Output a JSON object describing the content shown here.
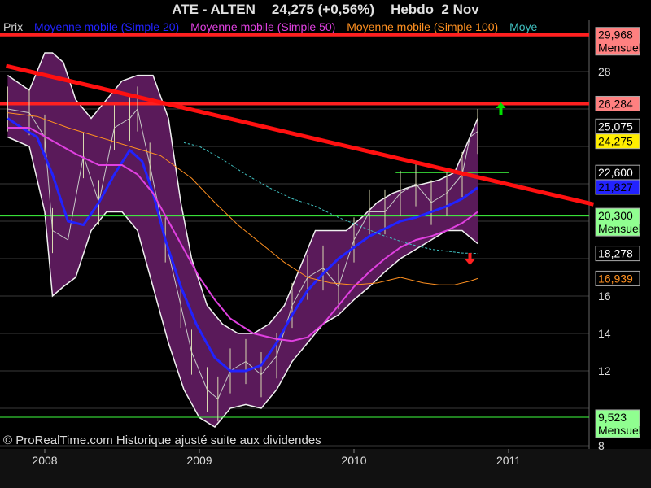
{
  "header": {
    "ticker": "ATE - ALTEN",
    "quote": "24,275 (+0,56%)",
    "period": "Hebdo  2 Nov"
  },
  "legend": [
    {
      "label": "Prix",
      "color": "#cccccc"
    },
    {
      "label": "Moyenne mobile (Simple 20)",
      "color": "#2222ff"
    },
    {
      "label": "Moyenne mobile (Simple 50)",
      "color": "#e040e0"
    },
    {
      "label": "Moyenne mobile (Simple 100)",
      "color": "#ff9020"
    },
    {
      "label": "Moye",
      "color": "#40c0c0"
    }
  ],
  "watermark": "© ProRealTime.com Historique ajusté suite aux dividendes",
  "chart_data": {
    "type": "line",
    "x_tick_labels": [
      "2008",
      "2009",
      "2010",
      "2011"
    ],
    "y_tick_labels": [
      "8",
      "12",
      "14",
      "16",
      "28"
    ],
    "ylim": [
      8,
      31
    ],
    "price_labels": [
      {
        "text": "29,968",
        "value": 29.968,
        "bg": "#ff8080",
        "fg": "#000000",
        "sub": "Mensuel"
      },
      {
        "text": "26,284",
        "value": 26.284,
        "bg": "#ff8080",
        "fg": "#000000",
        "sub": ""
      },
      {
        "text": "25,075",
        "value": 25.075,
        "bg": "#000000",
        "fg": "#ffffff",
        "sub": ""
      },
      {
        "text": "24,275",
        "value": 24.275,
        "bg": "#ffee00",
        "fg": "#000000",
        "sub": ""
      },
      {
        "text": "22,600",
        "value": 22.6,
        "bg": "#000000",
        "fg": "#ffffff",
        "sub": ""
      },
      {
        "text": "21,827",
        "value": 21.827,
        "bg": "#2222ff",
        "fg": "#000000",
        "sub": ""
      },
      {
        "text": "20,300",
        "value": 20.3,
        "bg": "#90ff90",
        "fg": "#000000",
        "sub": "Mensuel"
      },
      {
        "text": "18,278",
        "value": 18.278,
        "bg": "#000000",
        "fg": "#ffffff",
        "sub": ""
      },
      {
        "text": "16,939",
        "value": 16.939,
        "bg": "#000000",
        "fg": "#ff9020",
        "sub": ""
      },
      {
        "text": "9,523",
        "value": 9.523,
        "bg": "#90ff90",
        "fg": "#000000",
        "sub": "Mensuel"
      }
    ],
    "horizontal_levels": [
      {
        "value": 29.968,
        "color": "#ff2020",
        "width": 4
      },
      {
        "value": 26.284,
        "color": "#ff2020",
        "width": 4
      },
      {
        "value": 20.3,
        "color": "#40ff40",
        "width": 2
      },
      {
        "value": 9.523,
        "color": "#40ff40",
        "width": 1
      }
    ],
    "trendline": {
      "x": [
        2007.75,
        2011.55
      ],
      "y": [
        28.3,
        20.9
      ],
      "color": "#ff1010"
    },
    "resistance_segment": {
      "x": [
        2010.27,
        2011.0
      ],
      "y": [
        22.6,
        22.6
      ],
      "color": "#40ff40"
    },
    "series": [
      {
        "name": "Prix",
        "color": "#c8c8c8",
        "x": [
          2007.76,
          2007.9,
          2008.0,
          2008.05,
          2008.15,
          2008.25,
          2008.35,
          2008.45,
          2008.55,
          2008.6,
          2008.68,
          2008.78,
          2008.88,
          2008.95,
          2009.05,
          2009.12,
          2009.2,
          2009.3,
          2009.4,
          2009.5,
          2009.6,
          2009.7,
          2009.8,
          2009.9,
          2010.0,
          2010.1,
          2010.2,
          2010.3,
          2010.4,
          2010.5,
          2010.6,
          2010.7,
          2010.75,
          2010.8
        ],
        "y": [
          26.0,
          25.8,
          24.5,
          19.5,
          19.0,
          23.5,
          21.0,
          25.0,
          25.5,
          26.0,
          23.0,
          19.0,
          15.5,
          13.0,
          11.0,
          10.5,
          12.0,
          12.5,
          11.8,
          12.8,
          15.5,
          17.0,
          17.5,
          16.5,
          19.0,
          20.5,
          20.5,
          21.5,
          22.0,
          21.0,
          21.5,
          22.5,
          24.5,
          24.8
        ]
      },
      {
        "name": "Moyenne mobile (Simple 20)",
        "color": "#2222ff",
        "x": [
          2007.76,
          2007.85,
          2007.95,
          2008.05,
          2008.15,
          2008.25,
          2008.35,
          2008.45,
          2008.55,
          2008.63,
          2008.7,
          2008.78,
          2008.88,
          2008.98,
          2009.1,
          2009.2,
          2009.3,
          2009.4,
          2009.5,
          2009.6,
          2009.7,
          2009.8,
          2009.9,
          2010.0,
          2010.1,
          2010.2,
          2010.3,
          2010.4,
          2010.5,
          2010.6,
          2010.7,
          2010.8
        ],
        "y": [
          25.5,
          25.0,
          24.5,
          22.5,
          20.0,
          19.8,
          21.0,
          22.5,
          23.8,
          23.2,
          21.5,
          19.0,
          16.5,
          14.5,
          12.7,
          12.0,
          12.0,
          12.3,
          13.5,
          15.0,
          16.3,
          17.2,
          18.0,
          18.6,
          19.2,
          19.6,
          20.0,
          20.2,
          20.5,
          20.8,
          21.2,
          21.8
        ]
      },
      {
        "name": "Moyenne mobile (Simple 50)",
        "color": "#e040e0",
        "x": [
          2007.76,
          2007.9,
          2008.05,
          2008.2,
          2008.35,
          2008.5,
          2008.6,
          2008.7,
          2008.8,
          2008.9,
          2009.0,
          2009.1,
          2009.2,
          2009.35,
          2009.5,
          2009.6,
          2009.7,
          2009.8,
          2009.9,
          2010.0,
          2010.1,
          2010.2,
          2010.3,
          2010.4,
          2010.5,
          2010.6,
          2010.7,
          2010.8
        ],
        "y": [
          25.0,
          25.0,
          24.3,
          23.6,
          23.0,
          23.0,
          22.5,
          21.5,
          20.0,
          18.5,
          17.0,
          15.8,
          14.8,
          14.0,
          13.7,
          13.6,
          13.8,
          14.5,
          15.5,
          16.5,
          17.3,
          18.0,
          18.6,
          19.0,
          19.2,
          19.5,
          19.9,
          20.5
        ]
      },
      {
        "name": "Moyenne mobile (Simple 100)",
        "color": "#ff9020",
        "x": [
          2007.76,
          2007.95,
          2008.15,
          2008.35,
          2008.55,
          2008.75,
          2008.95,
          2009.1,
          2009.25,
          2009.4,
          2009.55,
          2009.7,
          2009.85,
          2010.0,
          2010.15,
          2010.3,
          2010.45,
          2010.55,
          2010.65,
          2010.75,
          2010.8
        ],
        "y": [
          25.8,
          25.6,
          25.0,
          24.5,
          24.0,
          23.5,
          22.3,
          21.0,
          19.8,
          18.8,
          17.8,
          17.0,
          16.7,
          16.6,
          16.7,
          17.0,
          16.7,
          16.6,
          16.6,
          16.8,
          16.94
        ]
      },
      {
        "name": "Moye",
        "color": "#40c0c0",
        "x": [
          2008.9,
          2009.0,
          2009.15,
          2009.3,
          2009.45,
          2009.6,
          2009.75,
          2009.9,
          2010.05,
          2010.2,
          2010.35,
          2010.5,
          2010.6,
          2010.7,
          2010.8
        ],
        "y": [
          24.2,
          24.0,
          23.3,
          22.5,
          21.8,
          21.2,
          20.8,
          20.2,
          19.7,
          19.2,
          18.8,
          18.5,
          18.4,
          18.3,
          18.28
        ]
      }
    ],
    "bollinger_upper": {
      "x": [
        2007.76,
        2007.9,
        2008.0,
        2008.05,
        2008.12,
        2008.2,
        2008.3,
        2008.4,
        2008.5,
        2008.6,
        2008.7,
        2008.8,
        2008.88,
        2008.95,
        2009.05,
        2009.15,
        2009.25,
        2009.35,
        2009.45,
        2009.55,
        2009.65,
        2009.75,
        2009.85,
        2009.95,
        2010.05,
        2010.15,
        2010.25,
        2010.35,
        2010.45,
        2010.55,
        2010.65,
        2010.75,
        2010.8
      ],
      "y": [
        27.8,
        27.0,
        29.0,
        29.0,
        28.5,
        26.5,
        25.5,
        26.5,
        27.5,
        27.8,
        27.8,
        25.5,
        21.0,
        18.0,
        15.5,
        14.5,
        14.0,
        14.0,
        14.5,
        15.5,
        17.5,
        19.5,
        19.5,
        19.5,
        20.2,
        21.0,
        21.5,
        21.8,
        22.0,
        22.2,
        22.6,
        24.5,
        25.5
      ]
    },
    "bollinger_lower": {
      "x": [
        2007.76,
        2007.9,
        2008.0,
        2008.05,
        2008.12,
        2008.2,
        2008.3,
        2008.4,
        2008.5,
        2008.6,
        2008.7,
        2008.8,
        2008.9,
        2009.0,
        2009.1,
        2009.2,
        2009.3,
        2009.4,
        2009.5,
        2009.6,
        2009.7,
        2009.8,
        2009.9,
        2010.0,
        2010.1,
        2010.2,
        2010.3,
        2010.4,
        2010.5,
        2010.6,
        2010.7,
        2010.8
      ],
      "y": [
        24.5,
        24.0,
        20.5,
        16.0,
        16.5,
        17.0,
        19.5,
        20.5,
        20.5,
        19.5,
        16.5,
        13.5,
        11.0,
        9.5,
        9.0,
        10.0,
        10.2,
        10.0,
        11.0,
        12.5,
        13.5,
        14.5,
        15.0,
        15.8,
        16.5,
        17.3,
        18.0,
        18.5,
        19.0,
        19.5,
        19.5,
        18.8
      ]
    },
    "arrows": [
      {
        "x": 2010.95,
        "y": 26.0,
        "direction": "up",
        "color": "#00e000"
      },
      {
        "x": 2010.75,
        "y": 18.0,
        "direction": "down",
        "color": "#ff2020"
      }
    ]
  }
}
